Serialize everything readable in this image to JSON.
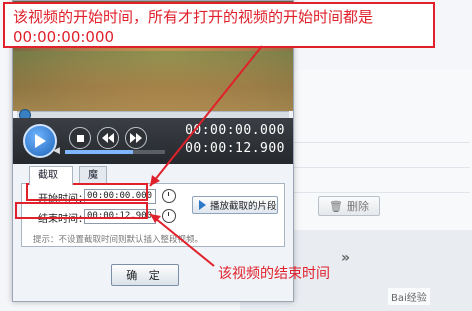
{
  "annotation_top": {
    "line1": "该视频的开始时间，所有才打开的视频的开始时间都是",
    "line2": "00:00:00:000"
  },
  "annotation_bottom": "该视频的结束时间",
  "player": {
    "current_time": "00:00:00.000",
    "total_time": "00:00:12.900"
  },
  "tabs": [
    {
      "label": "截取"
    },
    {
      "label": "魔术功能"
    }
  ],
  "clip": {
    "start_label": "开始时间：",
    "start_value": "00:00:00.000",
    "end_label": "结束时间：",
    "end_value": "00:00:12.900",
    "play_segment_label": "播放截取的片段",
    "hint": "提示：不设置截取时间则默认插入整段视频。"
  },
  "ok_label": "确 定",
  "background": {
    "delete_label": "删除"
  },
  "watermark": "Bai经验"
}
